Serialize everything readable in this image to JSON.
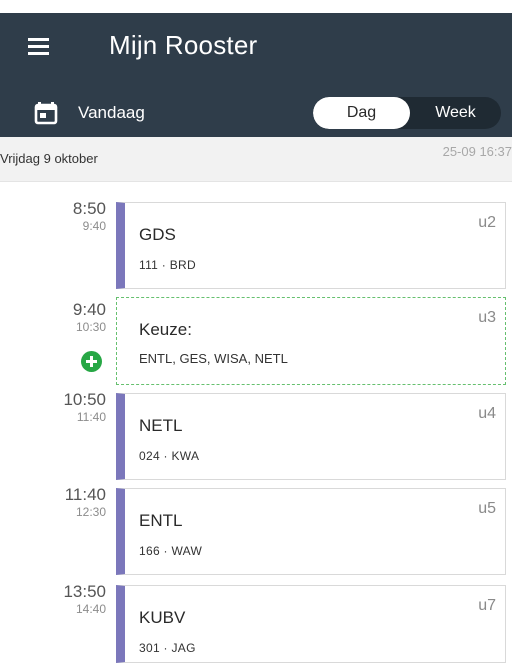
{
  "app_bar": {
    "title": "Mijn Rooster",
    "today_label": "Vandaag",
    "view_options": [
      "Dag",
      "Week"
    ],
    "selected_view": "Dag",
    "background_color": "#2f3d4a",
    "icons": {
      "menu": "menu-icon",
      "calendar": "calendar-icon"
    }
  },
  "date_bar": {
    "date": "Vrijdag 9 oktober",
    "updated": "25-09 16:37"
  },
  "lessons": [
    {
      "start": "8:50",
      "end": "9:40",
      "subject": "GDS",
      "detail": "111 · BRD",
      "hour": "u2",
      "type": "lesson"
    },
    {
      "start": "9:40",
      "end": "10:30",
      "subject": "Keuze:",
      "detail": "ENTL, GES, WISA, NETL",
      "hour": "u3",
      "type": "choice"
    },
    {
      "start": "10:50",
      "end": "11:40",
      "subject": "NETL",
      "detail": "024 · KWA",
      "hour": "u4",
      "type": "lesson"
    },
    {
      "start": "11:40",
      "end": "12:30",
      "subject": "ENTL",
      "detail": "166 · WAW",
      "hour": "u5",
      "type": "lesson"
    },
    {
      "start": "13:50",
      "end": "14:40",
      "subject": "KUBV",
      "detail": "301 · JAG",
      "hour": "u7",
      "type": "lesson"
    }
  ],
  "colors": {
    "lesson_accent": "#7b77bb",
    "choice_border": "#66c06f",
    "add_button": "#27a745"
  }
}
